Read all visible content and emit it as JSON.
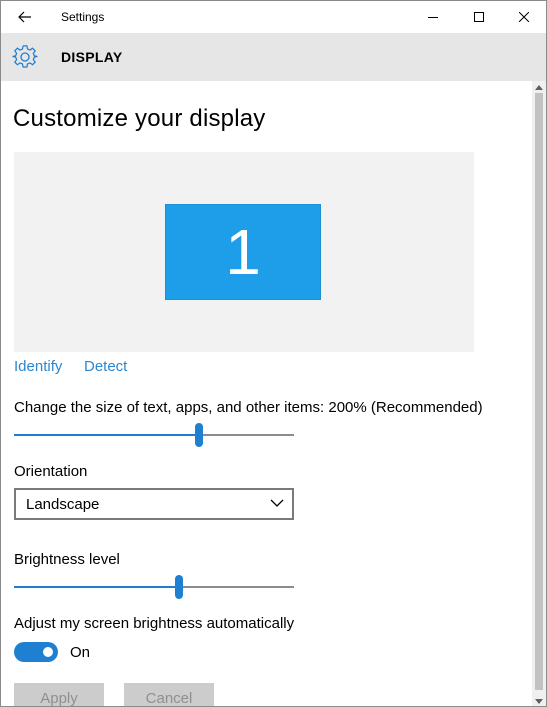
{
  "titlebar": {
    "title": "Settings",
    "icons": {
      "back": "back-arrow-icon",
      "minimize": "minimize-icon",
      "maximize": "maximize-icon",
      "close": "close-icon"
    }
  },
  "header": {
    "title": "DISPLAY",
    "icon": "gear-icon"
  },
  "page": {
    "title": "Customize your display",
    "monitor_number": "1",
    "links": {
      "identify": "Identify",
      "detect": "Detect"
    },
    "scale": {
      "label": "Change the size of text, apps, and other items: 200% (Recommended)",
      "level": 0.66
    },
    "orientation": {
      "label": "Orientation",
      "value": "Landscape"
    },
    "brightness": {
      "label": "Brightness level",
      "level": 0.59
    },
    "auto_brightness": {
      "label": "Adjust my screen brightness automatically",
      "toggle_state": "On"
    },
    "buttons": {
      "apply": "Apply",
      "cancel": "Cancel"
    }
  },
  "colors": {
    "accent": "#1f7fd1",
    "monitor": "#1e9ee9",
    "link": "#2a87d0",
    "header_bg": "#e6e6e6"
  }
}
